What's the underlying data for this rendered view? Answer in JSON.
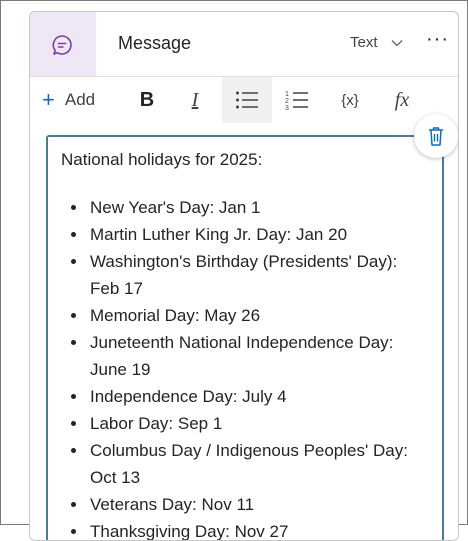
{
  "header": {
    "icon": "chat-bubble-icon",
    "title": "Message",
    "type_label": "Text",
    "type_icon": "chevron-down-icon",
    "more_label": "···"
  },
  "toolbar": {
    "add_label": "Add",
    "bold_glyph": "B",
    "italic_glyph": "I",
    "variable_glyph": "{x}",
    "formula_glyph": "fx"
  },
  "editor": {
    "intro": "National holidays for 2025:",
    "holidays": [
      "New Year's Day: Jan 1",
      "Martin Luther King Jr. Day: Jan 20",
      "Washington's Birthday (Presidents' Day): Feb 17",
      "Memorial Day: May 26",
      "Juneteenth National Independence Day: June 19",
      "Independence Day: July 4",
      "Labor Day: Sep 1",
      "Columbus Day / Indigenous Peoples' Day: Oct 13",
      "Veterans Day: Nov 11",
      "Thanksgiving Day: Nov 27"
    ]
  },
  "colors": {
    "accent": "#0f6cbd",
    "header_icon_bg": "#efe6f6",
    "icon_purple": "#7a3fa4",
    "editor_border": "#4a7b95"
  }
}
